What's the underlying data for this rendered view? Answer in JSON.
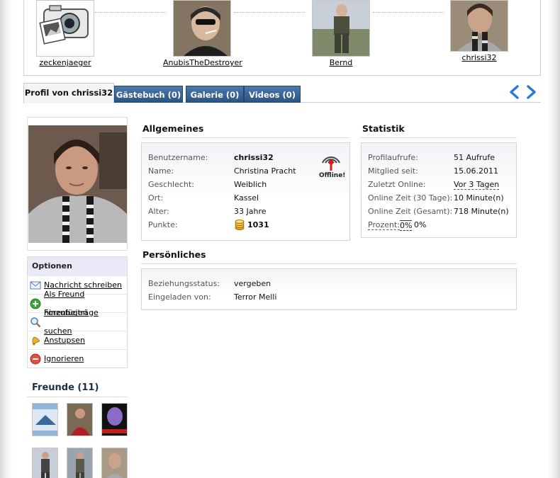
{
  "visitors": [
    {
      "name": "zeckenjaeger",
      "image": "camera-placeholder"
    },
    {
      "name": "AnubisTheDestroyer",
      "image": "user-photo"
    },
    {
      "name": "Bernd",
      "image": "user-photo"
    },
    {
      "name": "chrissi32",
      "image": "user-photo"
    }
  ],
  "tabs": [
    {
      "label": "Profil von chrissi32"
    },
    {
      "label": "Gästebuch (0)"
    },
    {
      "label": "Galerie (0)"
    },
    {
      "label": "Videos (0)"
    }
  ],
  "options": {
    "title": "Optionen",
    "items": [
      {
        "label": "Nachricht schreiben",
        "icon": "envelope-icon"
      },
      {
        "label": "Als Freund hinzufügen",
        "icon": "add-icon"
      },
      {
        "label": "Forenbeiträge suchen",
        "icon": "search-icon"
      },
      {
        "label": "Anstupsen",
        "icon": "bell-icon"
      },
      {
        "label": "Ignorieren",
        "icon": "block-icon"
      }
    ]
  },
  "friends": {
    "title": "Freunde (11)"
  },
  "general": {
    "title": "Allgemeines",
    "status_label": "Offline!",
    "rows": [
      {
        "label": "Benutzername:",
        "value": "chrissi32"
      },
      {
        "label": "Name:",
        "value": "Christina Pracht"
      },
      {
        "label": "Geschlecht:",
        "value": "Weiblich"
      },
      {
        "label": "Ort:",
        "value": "Kassel"
      },
      {
        "label": "Alter:",
        "value": "33 Jahre"
      },
      {
        "label": "Punkte:",
        "value": "1031"
      }
    ]
  },
  "stats": {
    "title": "Statistik",
    "rows": [
      {
        "label": "Profilaufrufe:",
        "value": "51 Aufrufe"
      },
      {
        "label": "Mitglied seit:",
        "value": "15.06.2011"
      },
      {
        "label": "Zuletzt Online:",
        "value": "Vor 3 Tagen"
      },
      {
        "label": "Online Zeit (30 Tage):",
        "value": "10 Minute(n)"
      },
      {
        "label": "Online Zeit (Gesamt):",
        "value": "718 Minute(n)"
      }
    ],
    "percent_label": "Prozent:",
    "percent_value_a": "0%",
    "percent_value_b": "0%"
  },
  "personal": {
    "title": "Persönliches",
    "rows": [
      {
        "label": "Beziehungsstatus:",
        "value": "vergeben"
      },
      {
        "label": "Eingeladen von:",
        "value": "Terror Melli"
      }
    ]
  },
  "colors": {
    "tab_blue": "#2c5584",
    "nav_arrow": "#2b7ad8",
    "link": "#000000"
  }
}
